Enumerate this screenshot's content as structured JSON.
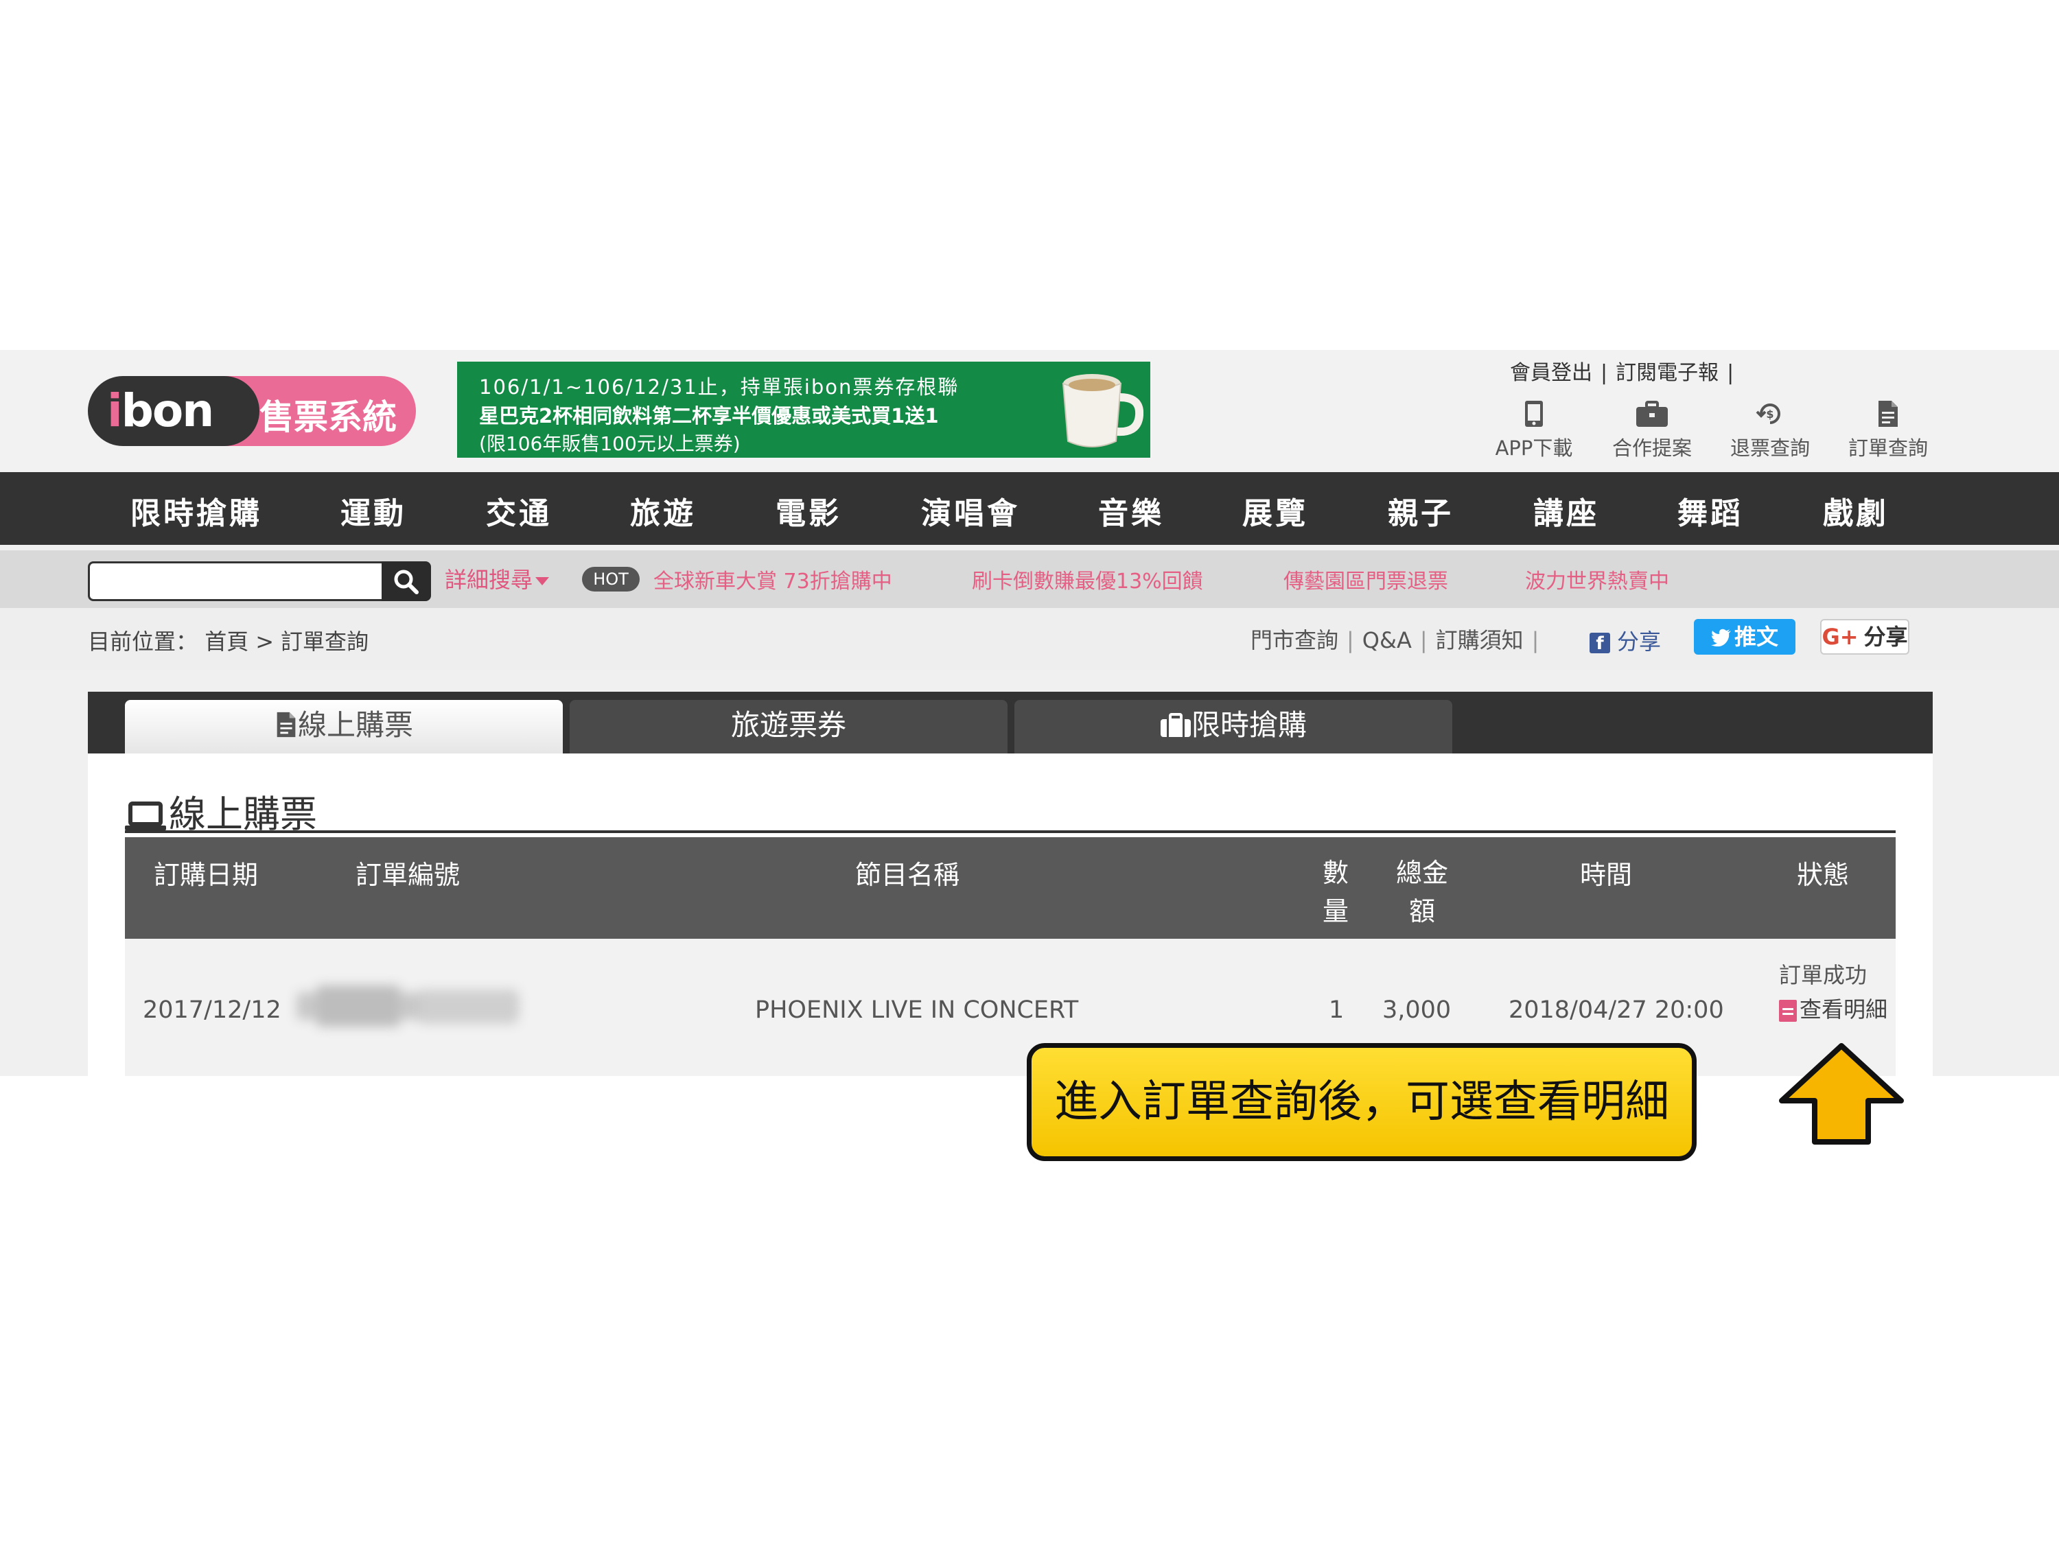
{
  "header": {
    "logo": {
      "brand": "ibon",
      "subtitle": "售票系統"
    },
    "banner": {
      "line1": "106/1/1~106/12/31止，持單張ibon票券存根聯",
      "line2": "星巴克2杯相同飲料第二杯享半價優惠或美式買1送1",
      "line3": "(限106年販售100元以上票券)"
    },
    "top_links": [
      "會員登出",
      "訂閱電子報"
    ],
    "top_sep": "|",
    "icon_links": [
      {
        "label": "APP下載",
        "icon": "mobile-icon"
      },
      {
        "label": "合作提案",
        "icon": "briefcase-icon"
      },
      {
        "label": "退票查詢",
        "icon": "refund-icon"
      },
      {
        "label": "訂單查詢",
        "icon": "document-icon"
      }
    ]
  },
  "nav": {
    "items": [
      "限時搶購",
      "運動",
      "交通",
      "旅遊",
      "電影",
      "演唱會",
      "音樂",
      "展覽",
      "親子",
      "講座",
      "舞蹈",
      "戲劇"
    ]
  },
  "search": {
    "value": "",
    "advanced_label": "詳細搜尋",
    "hot_badge": "HOT",
    "promos": [
      "全球新車大賞 73折搶購中",
      "刷卡倒數賺最優13%回饋",
      "傳藝園區門票退票",
      "波力世界熱賣中"
    ]
  },
  "breadcrumb": {
    "prefix": "目前位置：",
    "home": "首頁",
    "arrow": ">",
    "current": "訂單查詢"
  },
  "site_links": [
    "門市查詢",
    "Q&A",
    "訂購須知"
  ],
  "site_sep": "|",
  "social": {
    "fb_icon": "f",
    "fb_label": "分享",
    "twitter_label": "推文",
    "gplus_icon": "G+",
    "gplus_label": "分享"
  },
  "tabs": [
    {
      "label": "線上購票",
      "icon": "document-icon",
      "active": true
    },
    {
      "label": "旅遊票券",
      "icon": "",
      "active": false
    },
    {
      "label": "限時搶購",
      "icon": "suitcase-icon",
      "active": false
    }
  ],
  "section": {
    "title": "線上購票",
    "icon": "laptop-icon"
  },
  "table": {
    "headers": {
      "date": "訂購日期",
      "order_no": "訂單編號",
      "program": "節目名稱",
      "qty": [
        "數",
        "量"
      ],
      "total": [
        "總金",
        "額"
      ],
      "time": "時間",
      "status": "狀態"
    },
    "rows": [
      {
        "date": "2017/12/12",
        "order_no": "",
        "program": "PHOENIX LIVE IN CONCERT",
        "qty": "1",
        "total": "3,000",
        "time": "2018/04/27 20:00",
        "status": "訂單成功",
        "detail_link": "查看明細"
      }
    ]
  },
  "annotation": {
    "callout": "進入訂單查詢後，可選查看明細",
    "arrow_color": "#f7b500"
  },
  "colors": {
    "brand_pink": "#ea6b96",
    "nav_bg": "#333333",
    "banner_green": "#138a45",
    "twitter_blue": "#1da1f2",
    "facebook_blue": "#3b5998",
    "callout_yellow": "#ffd400"
  }
}
